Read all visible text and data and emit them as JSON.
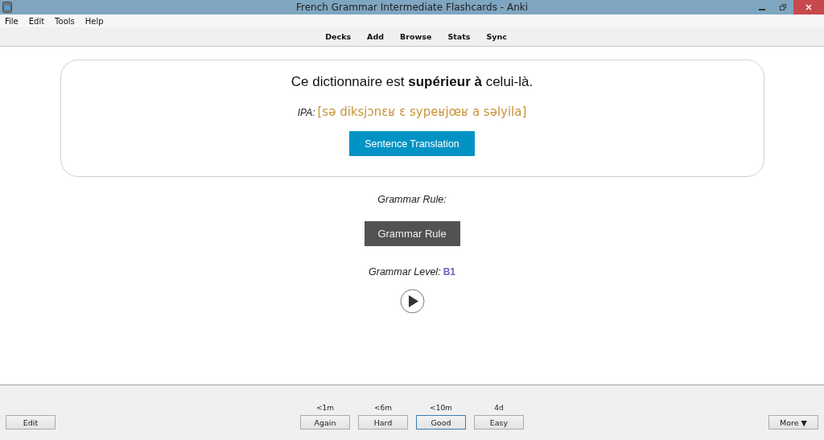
{
  "window": {
    "title": "French Grammar Intermediate Flashcards - Anki"
  },
  "menu": [
    "File",
    "Edit",
    "Tools",
    "Help"
  ],
  "toolbar": [
    "Decks",
    "Add",
    "Browse",
    "Stats",
    "Sync"
  ],
  "card": {
    "sentence": "Ce dictionnaire est **supérieur à** celui-là.",
    "ipa_label": "IPA:",
    "ipa": "[sə diksjɔnɛʁ ɛ sypeʁjœʁ a səlyila]",
    "translation_button": "Sentence Translation"
  },
  "grammar_rule_label": "Grammar Rule:",
  "grammar_rule_button": "Grammar Rule",
  "grammar_level": {
    "label": "Grammar Level:",
    "value": "B1"
  },
  "bottom": {
    "edit": "Edit",
    "more": "More ▼",
    "answers": [
      {
        "interval": "<1m",
        "label": "Again",
        "selected": false
      },
      {
        "interval": "<6m",
        "label": "Hard",
        "selected": false
      },
      {
        "interval": "<10m",
        "label": "Good",
        "selected": true
      },
      {
        "interval": "4d",
        "label": "Easy",
        "selected": false
      }
    ]
  }
}
